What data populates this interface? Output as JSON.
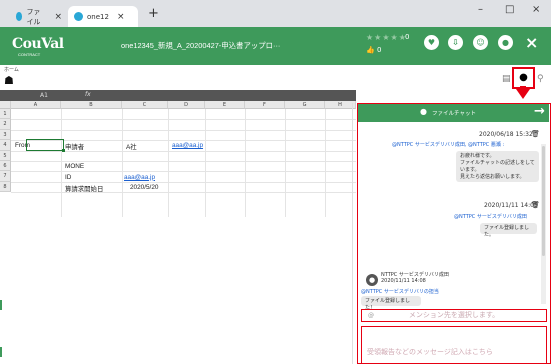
{
  "browser": {
    "tabs": [
      {
        "label": "ファイル",
        "close": "×"
      },
      {
        "label": "one12",
        "close": "×"
      }
    ],
    "new_tab": "+",
    "window_controls": [
      "–",
      "□",
      "×"
    ]
  },
  "header": {
    "logo": "CouVal",
    "logo_sub": "CONTRACT",
    "doc_title": "one12345_新規_A_20200427-申込書アップロ···",
    "stars": "★★★★★",
    "rating_count": "0",
    "likes_icon": "thumbs-up-icon",
    "likes": "0",
    "icons": [
      "heart-icon",
      "download-icon",
      "users-icon",
      "bell-icon"
    ],
    "close": "×"
  },
  "toolbar": {
    "home_label": "ホーム",
    "home_icon": "home-icon",
    "chat_icon": "chat-icon"
  },
  "formula_bar": {
    "cell_ref": "A1",
    "fx": "fx"
  },
  "sheet": {
    "columns": [
      "A",
      "B",
      "C",
      "D",
      "E",
      "F",
      "G",
      "H"
    ],
    "rows": [
      "1",
      "2",
      "3",
      "4",
      "5",
      "6",
      "7",
      "8"
    ],
    "cells": {
      "r3_a": "From",
      "r3_b": "申請者",
      "r3_c": "A社",
      "r3_d": "aaa@aa.jp",
      "r5_b": "MONE",
      "r6_b": "ID",
      "r6_c": "aaa@aa.jp",
      "r7_b": "算請求開始日",
      "r7_c": "2020/5/20"
    }
  },
  "chat_panel": {
    "title": "ファイルチャット",
    "forward_icon": "→",
    "messages": [
      {
        "time": "2020/06/18 15:32",
        "to": "@NTTPC サービスデリバリ成田, @NTTPC 悪瀬 :",
        "lines": [
          "お疲れ様です。",
          "ファイルチャットの記述しをしています。",
          "見えたら返信お願いします。"
        ]
      },
      {
        "time": "2020/11/11 14:05",
        "to": "@NTTPC サービスデリバリ成田",
        "lines": [
          "ファイル登録しました。"
        ]
      },
      {
        "sender": "NTTPC サービスデリバリ成田",
        "time": "2020/11/11 14:08",
        "to": "@NTTPC サービスデリバリの担当",
        "lines": [
          "ファイル登録しました！"
        ]
      }
    ],
    "mention_placeholder": "メンション先を選択します。",
    "mention_at": "@",
    "composer_placeholder": "受領報告などのメッセージ記入はこちら"
  },
  "colors": {
    "brand": "#3e9a5b",
    "highlight": "#e60012",
    "link": "#1a5fd0"
  }
}
